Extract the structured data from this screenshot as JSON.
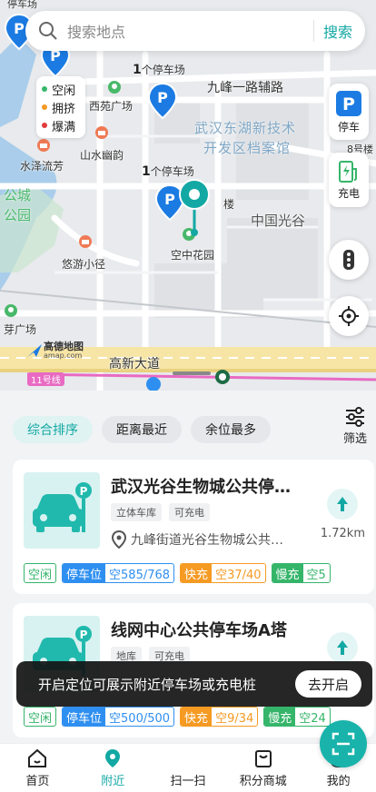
{
  "search": {
    "placeholder": "搜索地点",
    "button": "搜索"
  },
  "legend": [
    {
      "label": "空闲",
      "color": "#35b56a"
    },
    {
      "label": "拥挤",
      "color": "#f59a23"
    },
    {
      "label": "爆满",
      "color": "#e23b3b"
    }
  ],
  "map": {
    "labels": {
      "xiyuan": "西苑广场",
      "jiufeng": "九峰一路辅路",
      "archive1": "武汉东湖新技术",
      "archive2": "开发区档案馆",
      "shanshui": "山水幽韵",
      "shuize": "水泽流芳",
      "lou8": "8号楼",
      "city1": "公城",
      "city2": "公园",
      "lou": "楼",
      "guanggu": "中国光谷",
      "kongzhong": "空中花园",
      "youyou": "悠游小径",
      "fangguang": "芽广场",
      "gaoxin": "高新大道",
      "metro": "11号线",
      "top": "停车场",
      "amap1": "高德地图",
      "amap2": "amap.com"
    },
    "lot_count_1": {
      "num": "1",
      "unit": "个停车场"
    },
    "lot_count_2": {
      "num": "1",
      "unit": "个停车场"
    }
  },
  "side": {
    "parking": "停车",
    "charge": "充电"
  },
  "sort": {
    "tabs": [
      "综合排序",
      "距离最近",
      "余位最多"
    ],
    "filter": "筛选"
  },
  "cards": [
    {
      "name": "武汉光谷生物城公共停…",
      "tags": [
        "立体车库",
        "可充电"
      ],
      "address": "九峰街道光谷生物城公共…",
      "distance": "1.72km",
      "free": "空闲",
      "parking_k": "停车位",
      "parking_v": "空585/768",
      "fast_k": "快充",
      "fast_v": "空37/40",
      "slow_k": "慢充",
      "slow_v": "空5"
    },
    {
      "name": "线网中心公共停车场A塔",
      "tags": [
        "地库",
        "可充电"
      ],
      "free": "空闲",
      "parking_k": "停车位",
      "parking_v": "空500/500",
      "fast_k": "快充",
      "fast_v": "空9/34",
      "slow_k": "慢充",
      "slow_v": "空24"
    }
  ],
  "toast": {
    "message": "开启定位可展示附近停车场或充电桩",
    "button": "去开启"
  },
  "tabbar": [
    "首页",
    "附近",
    "扫一扫",
    "积分商城",
    "我的"
  ]
}
